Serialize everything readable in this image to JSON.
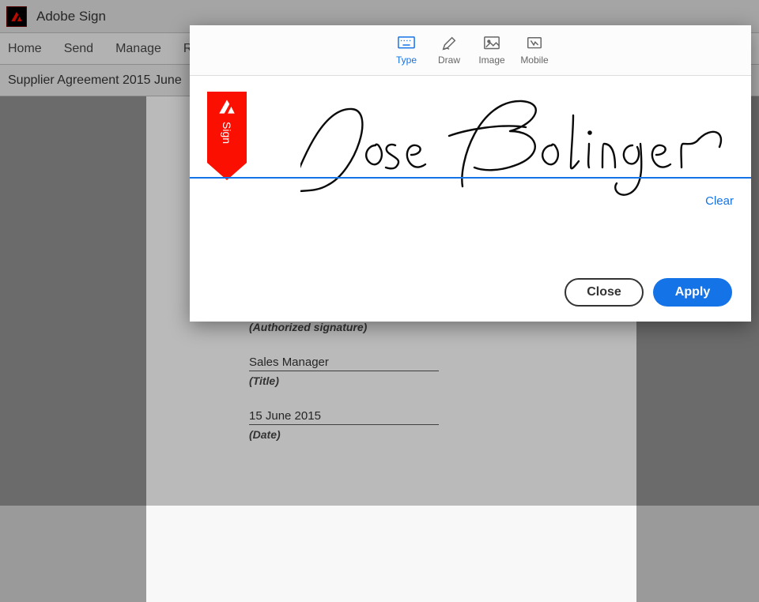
{
  "titlebar": {
    "app_name": "Adobe Sign"
  },
  "nav": {
    "items": [
      "Home",
      "Send",
      "Manage",
      "Reports"
    ]
  },
  "breadcrumb": {
    "doc_title": "Supplier Agreement 2015 June"
  },
  "document": {
    "signature_label": "(Authorized signature)",
    "title_value": "Sales Manager",
    "title_label": "(Title)",
    "date_value": "15 June 2015",
    "date_label": "(Date)"
  },
  "modal": {
    "tabs": [
      {
        "label": "Type",
        "active": true
      },
      {
        "label": "Draw",
        "active": false
      },
      {
        "label": "Image",
        "active": false
      },
      {
        "label": "Mobile",
        "active": false
      }
    ],
    "badge_text": "Sign",
    "signature_value": "Jose Bolinger",
    "clear_label": "Clear",
    "close_label": "Close",
    "apply_label": "Apply"
  },
  "colors": {
    "accent": "#1473e6",
    "adobe_red": "#fa0f00"
  }
}
